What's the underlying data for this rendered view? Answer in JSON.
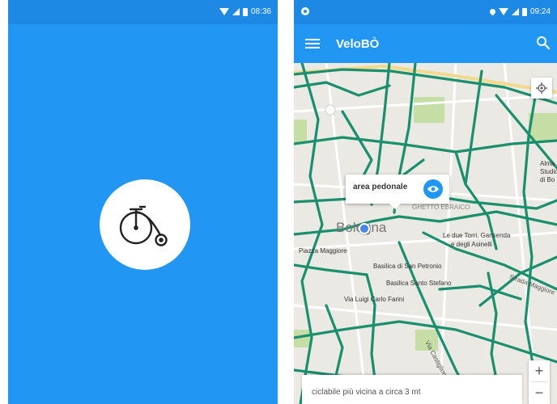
{
  "splash": {
    "status": {
      "time": "08:36"
    },
    "logo_icon": "penny-farthing-bicycle-icon"
  },
  "map_app": {
    "status": {
      "time": "09:24"
    },
    "appbar": {
      "title": "VeloBÒ",
      "menu_icon": "hamburger-menu-icon",
      "search_icon": "search-icon"
    },
    "map": {
      "city_label": "Bologna",
      "labels": {
        "piazza_maggiore": "Piazza Maggiore",
        "basilica_petronio": "Basilica di San Petronio",
        "basilica_stefano": "Basilica Santo Stefano",
        "via_farini": "Via Luigi Carlo Farini",
        "due_torri": "Le due Torri, Garisenda",
        "asinelli": "e degli Asinelli",
        "ghetto": "GHETTO EBRAICO",
        "via_castiglione": "Via Castiglione",
        "alma": "Alma",
        "studio": "Studio",
        "di_bo": "di Bo",
        "strada_maggiore": "Strada Maggiore"
      }
    },
    "popup": {
      "label": "area pedonale",
      "icon": "eye-icon"
    },
    "bottom_card": {
      "text": "ciclabile più vicina a circa 3 mt"
    },
    "zoom": {
      "in_label": "+",
      "out_label": "−"
    },
    "colors": {
      "primary": "#2196f3",
      "bike_path": "#1a8f6e"
    }
  }
}
